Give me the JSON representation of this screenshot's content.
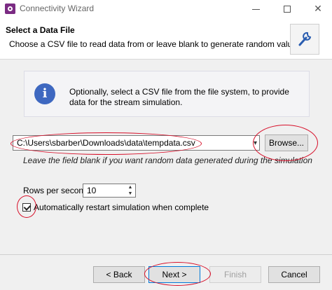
{
  "window": {
    "title": "Connectivity Wizard",
    "minimize_icon": "minimize-icon",
    "maximize_icon": "maximize-icon",
    "close_glyph": "✕"
  },
  "header": {
    "title": "Select a Data File",
    "description": "Choose a CSV file to read data from or leave blank to generate random values",
    "icon": "wrench-icon"
  },
  "info": {
    "icon_glyph": "i",
    "text": "Optionally, select a CSV file from the file system, to provide data for the stream simulation."
  },
  "file": {
    "value": "C:\\Users\\sbarber\\Downloads\\data\\tempdata.csv",
    "dropdown_glyph": "▾",
    "browse_label": "Browse...",
    "hint": "Leave the field blank if you want random data generated during the simulation"
  },
  "rows": {
    "label": "Rows per second:",
    "value": "10",
    "up_glyph": "▲",
    "down_glyph": "▼"
  },
  "restart": {
    "label": "Automatically restart simulation when complete",
    "checked": true
  },
  "footer": {
    "back_label": "< Back",
    "next_label": "Next >",
    "finish_label": "Finish",
    "cancel_label": "Cancel"
  },
  "colors": {
    "annotation": "#d7102a",
    "info_icon": "#3e68c0",
    "app_icon": "#7b2b83"
  }
}
